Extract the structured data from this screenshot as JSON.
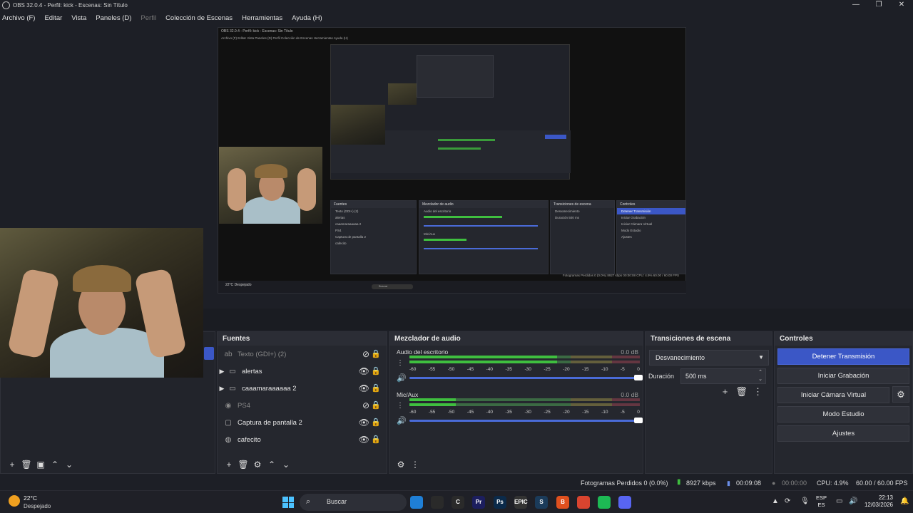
{
  "window": {
    "title": "OBS 32.0.4 - Perfil: kick - Escenas: Sin Título",
    "controls": [
      "—",
      "❐",
      "✕"
    ]
  },
  "menu": [
    "Archivo (F)",
    "Editar",
    "Vista",
    "Paneles (D)",
    "Perfil",
    "Colección de Escenas",
    "Herramientas",
    "Ayuda (H)"
  ],
  "nested_preview": {
    "title": "OBS 32.0.4 - Perfil: kick - Escenas: Sin Título",
    "menu": "Archivo (F)   Editar   Vista   Paneles (D)   Perfil   Colección de Escenas   Herramientas   Ayuda (H)",
    "sources_header": "Fuentes",
    "sources": [
      "Texto (GDI+) (2)",
      "alertas",
      "caaamaraaaaaa 2",
      "PS4",
      "Captura de pantalla 2",
      "cafecito"
    ],
    "mixer_header": "Mezclador de audio",
    "mixer_ch1": "Audio del escritorio",
    "mixer_ch2": "Mic/Aux",
    "trans_header": "Transiciones de escena",
    "trans_select": "Desvanecimiento",
    "trans_duration_label": "Duración",
    "trans_duration": "500 ms",
    "controls_header": "Controles",
    "controls": [
      "Detener Transmisión",
      "Iniciar Grabación",
      "Iniciar Cámara Virtual",
      "Modo Estudio",
      "Ajustes"
    ],
    "status": "Fotogramas Perdidos 0 (0.0%)   8927 kbps   00:00:08   CPU: 4.9%   60.00 / 60.00 FPS",
    "taskbar_temp": "22°C",
    "taskbar_cond": "Despejado",
    "taskbar_search": "Buscar"
  },
  "sources": {
    "header": "Fuentes",
    "items": [
      {
        "label": "Texto (GDI+) (2)",
        "icon": "text-icon",
        "visible": false,
        "dim": true,
        "group": false
      },
      {
        "label": "alertas",
        "icon": "folder-icon",
        "visible": true,
        "dim": false,
        "group": true
      },
      {
        "label": "caaamaraaaaaa 2",
        "icon": "folder-icon",
        "visible": true,
        "dim": false,
        "group": true
      },
      {
        "label": "PS4",
        "icon": "camera-icon",
        "visible": false,
        "dim": true,
        "group": false
      },
      {
        "label": "Captura de pantalla 2",
        "icon": "monitor-icon",
        "visible": true,
        "dim": false,
        "group": false
      },
      {
        "label": "cafecito",
        "icon": "globe-icon",
        "visible": true,
        "dim": false,
        "group": false
      }
    ]
  },
  "mixer": {
    "header": "Mezclador de audio",
    "ticks": [
      "-60",
      "-55",
      "-50",
      "-45",
      "-40",
      "-35",
      "-30",
      "-25",
      "-20",
      "-15",
      "-10",
      "-5",
      "0"
    ],
    "channels": [
      {
        "name": "Audio del escritorio",
        "db": "0.0 dB"
      },
      {
        "name": "Mic/Aux",
        "db": "0.0 dB"
      }
    ]
  },
  "transitions": {
    "header": "Transiciones de escena",
    "selected": "Desvanecimiento",
    "duration_label": "Duración",
    "duration_value": "500 ms"
  },
  "controls": {
    "header": "Controles",
    "stop_stream": "Detener Transmisión",
    "start_record": "Iniciar Grabación",
    "start_vcam": "Iniciar Cámara Virtual",
    "studio_mode": "Modo Estudio",
    "settings": "Ajustes"
  },
  "status": {
    "dropped": "Fotogramas Perdidos 0 (0.0%)",
    "bitrate": "8927 kbps",
    "stream_time": "00:09:08",
    "record_time": "00:00:00",
    "cpu": "CPU: 4.9%",
    "fps": "60.00 / 60.00 FPS"
  },
  "taskbar": {
    "temp": "22°C",
    "condition": "Despejado",
    "search": "Buscar",
    "lang_top": "ESP",
    "lang_bottom": "ES",
    "time": "22:13",
    "date": "12/03/2026",
    "apps": [
      {
        "name": "file-explorer-icon",
        "label": "",
        "color": "#1f7fd6"
      },
      {
        "name": "obs-icon",
        "label": "",
        "color": "#2a2a2a"
      },
      {
        "name": "ccleaner-icon",
        "label": "C",
        "color": "#2a2a2a"
      },
      {
        "name": "premiere-icon",
        "label": "Pr",
        "color": "#1c1e5e"
      },
      {
        "name": "photoshop-icon",
        "label": "Ps",
        "color": "#0b2a4a"
      },
      {
        "name": "epic-games-icon",
        "label": "EPIC",
        "color": "#333333"
      },
      {
        "name": "steam-icon",
        "label": "S",
        "color": "#1b3b5a"
      },
      {
        "name": "brave-icon",
        "label": "B",
        "color": "#e0501e"
      },
      {
        "name": "chrome-icon",
        "label": "",
        "color": "#d9442f"
      },
      {
        "name": "spotify-icon",
        "label": "",
        "color": "#1db954"
      },
      {
        "name": "discord-icon",
        "label": "",
        "color": "#5865f2"
      }
    ]
  },
  "colors": {
    "accent": "#3b57c6",
    "meter_green": "#3fbf3f",
    "meter_yellow": "#b5a02a",
    "meter_red": "#b52a3a"
  }
}
